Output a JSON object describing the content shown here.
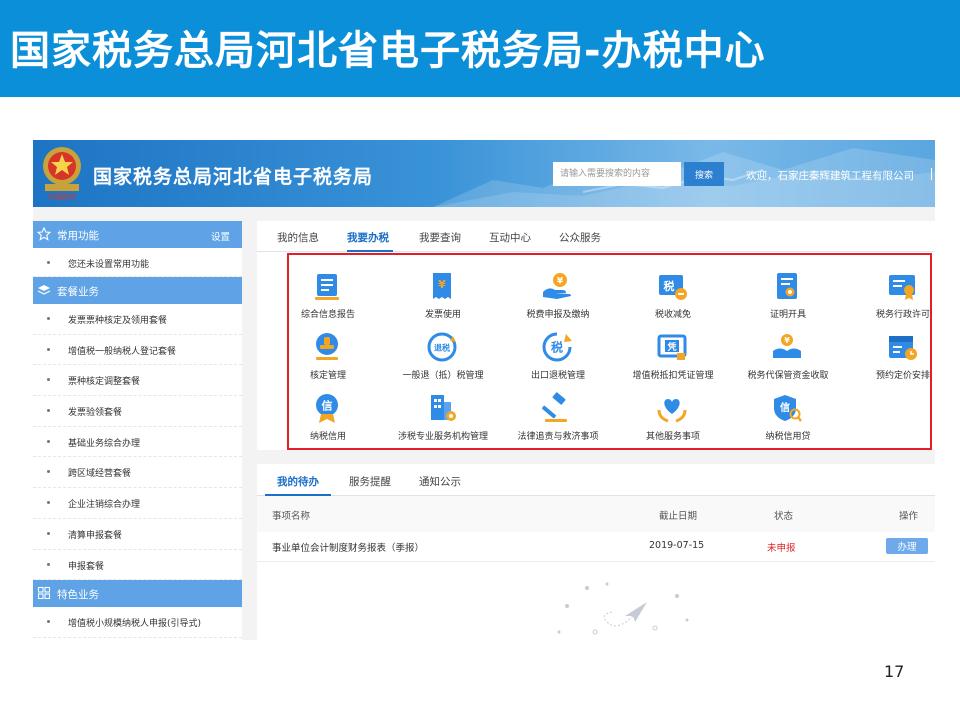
{
  "slide": {
    "title": "国家税务总局河北省电子税务局-办税中心",
    "page_number": "17",
    "colors": {
      "banner": "#0b8fd8",
      "sidebar_cat": "#5fa3e6",
      "highlight_box": "#e21e26",
      "accent": "#1a6fc7"
    }
  },
  "header": {
    "site_title": "国家税务总局河北省电子税务局",
    "emblem_text": "中国税务",
    "search_placeholder": "请输入需要搜索的内容",
    "search_button": "搜索",
    "welcome": "欢迎，石家庄秦辉建筑工程有限公司"
  },
  "sidebar": {
    "common": {
      "label": "常用功能",
      "settings": "设置",
      "icon": "star-icon"
    },
    "common_items": [
      {
        "label": "您还未设置常用功能"
      }
    ],
    "package": {
      "label": "套餐业务",
      "icon": "layers-icon"
    },
    "package_items": [
      {
        "label": "发票票种核定及领用套餐"
      },
      {
        "label": "增值税一般纳税人登记套餐"
      },
      {
        "label": "票种核定调整套餐"
      },
      {
        "label": "发票验领套餐"
      },
      {
        "label": "基础业务综合办理"
      },
      {
        "label": "跨区域经营套餐"
      },
      {
        "label": "企业注销综合办理"
      },
      {
        "label": "清算申报套餐"
      },
      {
        "label": "申报套餐"
      }
    ],
    "special": {
      "label": "特色业务",
      "icon": "grid-icon"
    },
    "special_items": [
      {
        "label": "增值税小规模纳税人申报(引导式)"
      }
    ]
  },
  "main_tabs": [
    {
      "label": "我的信息"
    },
    {
      "label": "我要办税"
    },
    {
      "label": "我要查询"
    },
    {
      "label": "互动中心"
    },
    {
      "label": "公众服务"
    }
  ],
  "services": [
    {
      "label": "综合信息报告",
      "icon": "report-icon"
    },
    {
      "label": "发票使用",
      "icon": "invoice-icon"
    },
    {
      "label": "税费申报及缴纳",
      "icon": "payment-hand-icon"
    },
    {
      "label": "税收减免",
      "icon": "tax-reduction-icon",
      "glyph": "税"
    },
    {
      "label": "证明开具",
      "icon": "certificate-icon"
    },
    {
      "label": "税务行政许可",
      "icon": "license-icon"
    },
    {
      "label": "核定管理",
      "icon": "stamp-icon"
    },
    {
      "label": "一般退（抵）税管理",
      "icon": "refund-icon",
      "glyph": "退税"
    },
    {
      "label": "出口退税管理",
      "icon": "export-refund-icon",
      "glyph": "税"
    },
    {
      "label": "增值税抵扣凭证管理",
      "icon": "voucher-icon",
      "glyph": "凭"
    },
    {
      "label": "税务代保管资金收取",
      "icon": "custody-funds-icon"
    },
    {
      "label": "预约定价安排",
      "icon": "schedule-icon"
    },
    {
      "label": "纳税信用",
      "icon": "credit-medal-icon",
      "glyph": "信"
    },
    {
      "label": "涉税专业服务机构管理",
      "icon": "agency-building-icon"
    },
    {
      "label": "法律追责与救济事项",
      "icon": "gavel-icon"
    },
    {
      "label": "其他服务事项",
      "icon": "heart-hands-icon"
    },
    {
      "label": "纳税信用贷",
      "icon": "credit-loan-icon",
      "glyph": "信"
    }
  ],
  "todo_tabs": [
    {
      "label": "我的待办"
    },
    {
      "label": "服务提醒"
    },
    {
      "label": "通知公示"
    }
  ],
  "todo_table": {
    "headers": {
      "name": "事项名称",
      "deadline": "截止日期",
      "status": "状态",
      "action": "操作"
    },
    "rows": [
      {
        "name": "事业单位会计制度财务报表（季报）",
        "deadline": "2019-07-15",
        "status": "未申报",
        "action": "办理"
      }
    ]
  }
}
